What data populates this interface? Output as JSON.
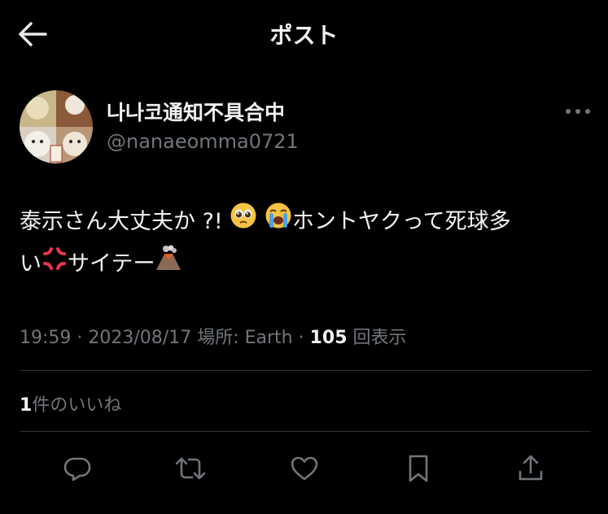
{
  "header": {
    "title": "ポスト",
    "back_icon": "arrow-left-icon"
  },
  "author": {
    "name": "나나코通知不具合中",
    "handle": "@nanaeomma0721",
    "avatar_icon": "avatar-collage"
  },
  "tweet": {
    "line1_text": "泰示さん大丈夫か ?! ",
    "line1_after_emoji": "ホントヤクって死球多",
    "line2_start": "い",
    "line2_text": "サイテー",
    "emojis": [
      "pleading-face-emoji",
      "loudly-crying-face-emoji",
      "anger-symbol-emoji",
      "volcano-emoji"
    ]
  },
  "meta": {
    "time": "19:59",
    "sep1": " · ",
    "date": "2023/08/17",
    "location": " 場所: Earth",
    "sep2": " · ",
    "views_count": "105",
    "views_label": " 回表示"
  },
  "likes": {
    "count": "1",
    "label": "件のいいね"
  },
  "actions": {
    "reply_icon": "reply-icon",
    "repost_icon": "repost-icon",
    "like_icon": "heart-icon",
    "bookmark_icon": "bookmark-icon",
    "share_icon": "share-icon"
  },
  "colors": {
    "background": "#000000",
    "text": "#e7e9ea",
    "secondary": "#71767b",
    "divider": "#2f3336"
  }
}
